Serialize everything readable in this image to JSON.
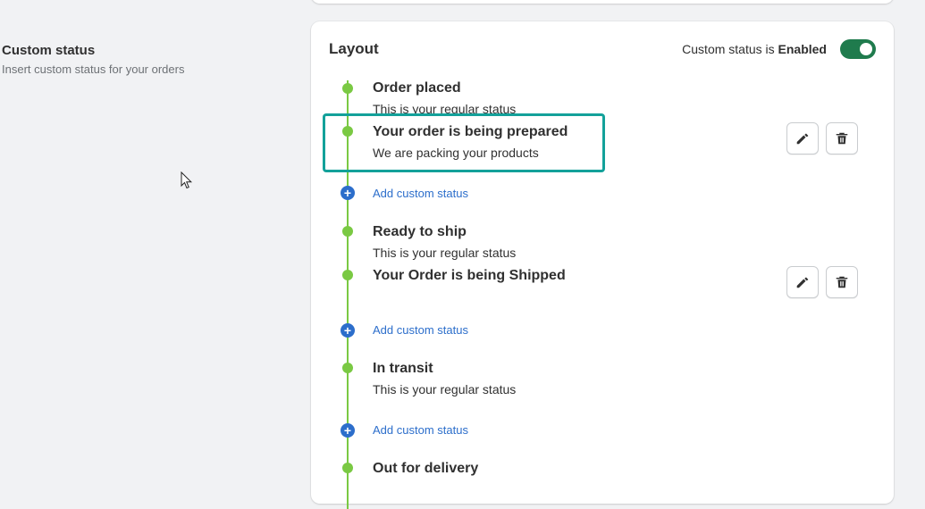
{
  "left": {
    "title": "Custom status",
    "description": "Insert custom status for your orders"
  },
  "card": {
    "title": "Layout",
    "toggle_prefix": "Custom status is ",
    "toggle_state": "Enabled"
  },
  "steps": [
    {
      "title": "Order placed",
      "desc": "This is your regular status"
    },
    {
      "title": "Your order is being prepared",
      "desc": "We are packing your products"
    },
    {
      "title": "Ready to ship",
      "desc": "This is your regular status"
    },
    {
      "title": "Your Order is being Shipped",
      "desc": ""
    },
    {
      "title": "In transit",
      "desc": "This is your regular status"
    },
    {
      "title": "Out for delivery",
      "desc": ""
    }
  ],
  "add_custom_label": "Add custom status",
  "colors": {
    "timeline": "#7ac943",
    "link": "#2c6ecb",
    "toggle_on": "#1f7b4d",
    "highlight": "#13a19a"
  },
  "icons": [
    "pencil-icon",
    "trash-icon",
    "plus-circle-icon",
    "cursor-icon"
  ]
}
